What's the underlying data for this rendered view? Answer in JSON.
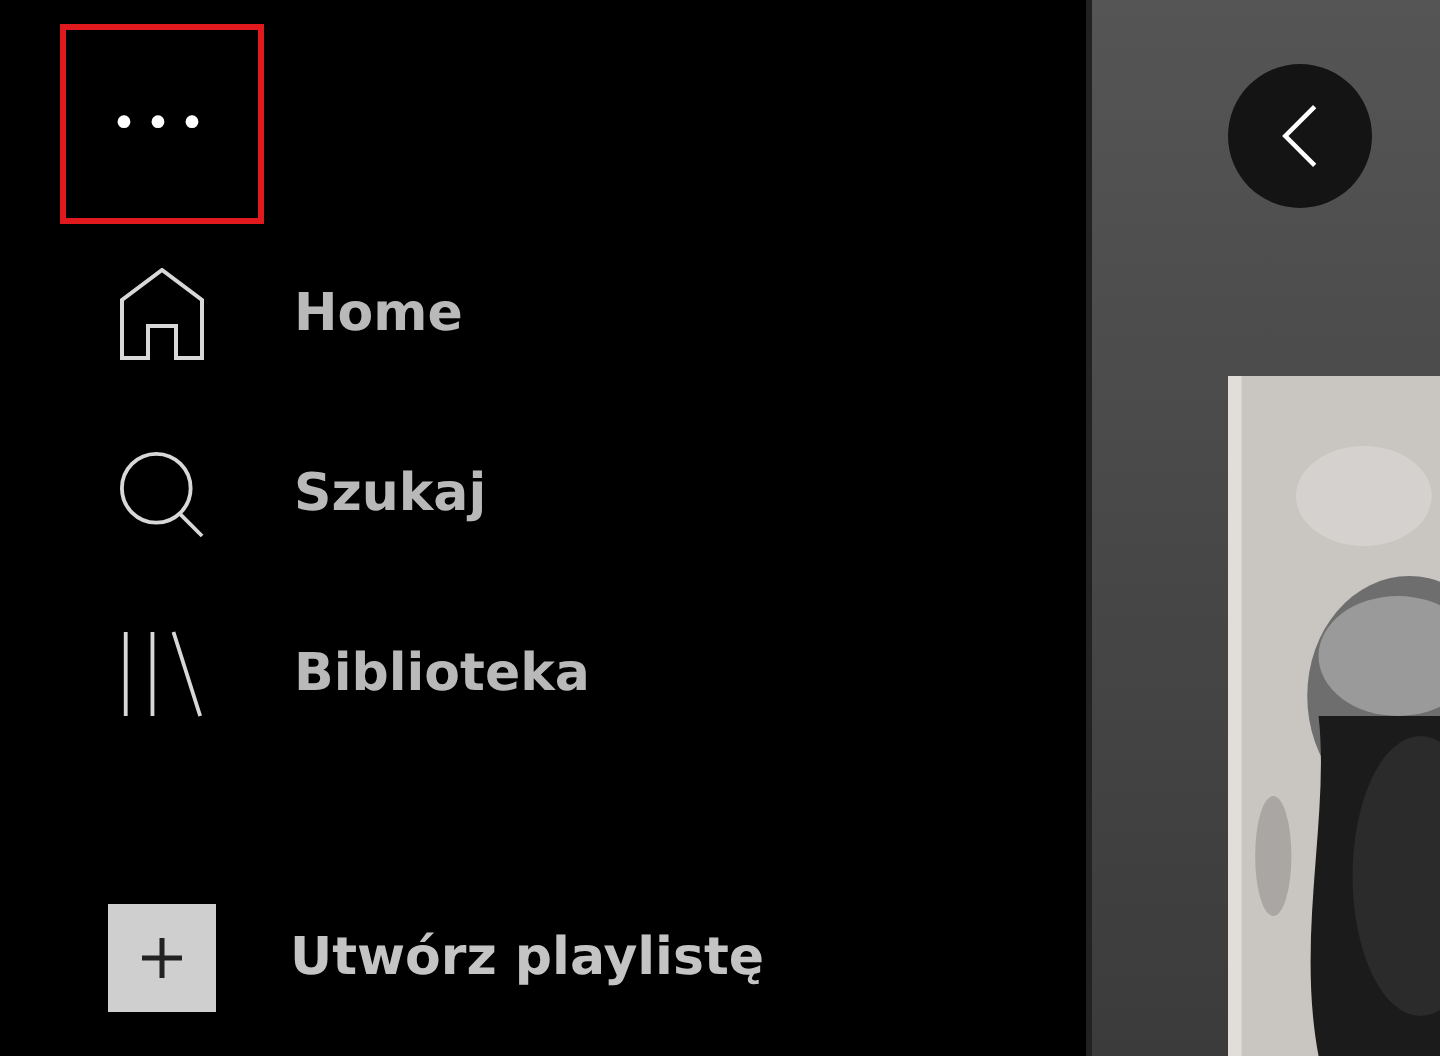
{
  "sidebar": {
    "menu_button": {
      "label": "•••",
      "highlighted": true
    },
    "nav": [
      {
        "label": "Home",
        "kind": "home",
        "selected": false
      },
      {
        "label": "Szukaj",
        "kind": "search",
        "selected": false
      },
      {
        "label": "Biblioteka",
        "kind": "library",
        "selected": false
      }
    ],
    "create_playlist": {
      "label": "Utwórz playlistę"
    }
  },
  "main": {
    "buttons": [
      {
        "kind": "back"
      }
    ]
  }
}
